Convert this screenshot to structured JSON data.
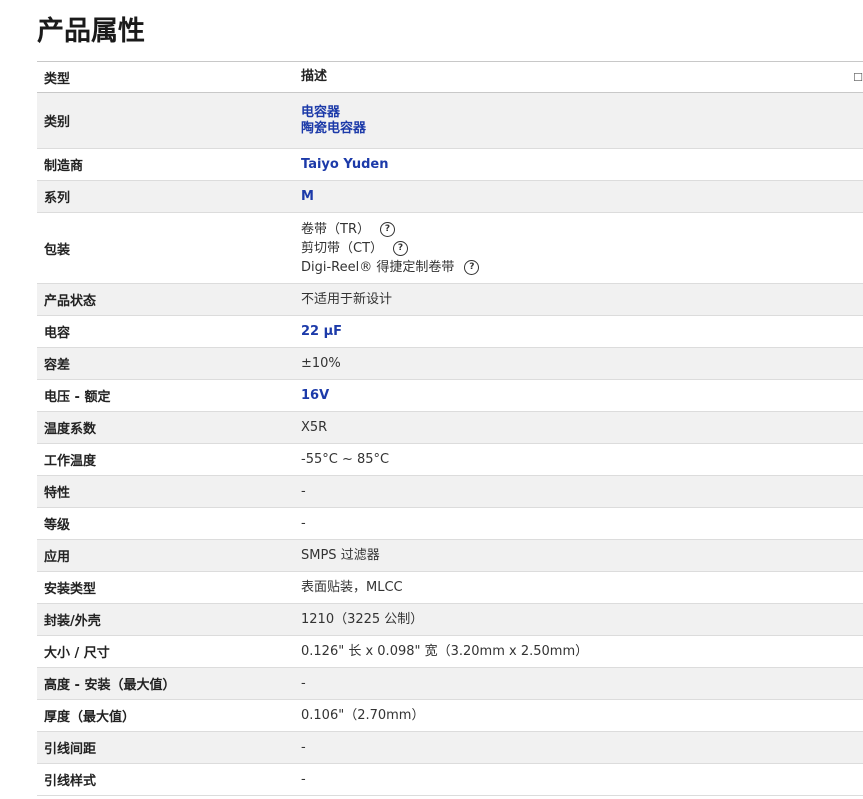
{
  "page": {
    "title": "产品属性"
  },
  "table": {
    "headers": {
      "type": "类型",
      "description": "描述"
    },
    "rows": [
      {
        "label": "类别",
        "values": [
          "电容器",
          "陶瓷电容器"
        ],
        "style": "link"
      },
      {
        "label": "制造商",
        "values": [
          "Taiyo Yuden"
        ],
        "style": "link"
      },
      {
        "label": "系列",
        "values": [
          "M"
        ],
        "style": "link"
      },
      {
        "label": "包装",
        "values": [
          "卷带（TR）",
          "剪切带（CT）",
          "Digi-Reel® 得捷定制卷带"
        ],
        "style": "help"
      },
      {
        "label": "产品状态",
        "values": [
          "不适用于新设计"
        ],
        "style": "plain"
      },
      {
        "label": "电容",
        "values": [
          "22 µF"
        ],
        "style": "link"
      },
      {
        "label": "容差",
        "values": [
          "±10%"
        ],
        "style": "plain"
      },
      {
        "label": "电压 - 额定",
        "values": [
          "16V"
        ],
        "style": "link"
      },
      {
        "label": "温度系数",
        "values": [
          "X5R"
        ],
        "style": "plain"
      },
      {
        "label": "工作温度",
        "values": [
          "-55°C ~ 85°C"
        ],
        "style": "plain"
      },
      {
        "label": "特性",
        "values": [
          "-"
        ],
        "style": "plain"
      },
      {
        "label": "等级",
        "values": [
          "-"
        ],
        "style": "plain"
      },
      {
        "label": "应用",
        "values": [
          "SMPS 过滤器"
        ],
        "style": "plain"
      },
      {
        "label": "安装类型",
        "values": [
          "表面贴装，MLCC"
        ],
        "style": "plain"
      },
      {
        "label": "封装/外壳",
        "values": [
          "1210（3225 公制）"
        ],
        "style": "plain"
      },
      {
        "label": "大小 / 尺寸",
        "values": [
          "0.126\" 长 x 0.098\" 宽（3.20mm x 2.50mm）"
        ],
        "style": "plain"
      },
      {
        "label": "高度 - 安装（最大值）",
        "values": [
          "-"
        ],
        "style": "plain"
      },
      {
        "label": "厚度（最大值）",
        "values": [
          "0.106\"（2.70mm）"
        ],
        "style": "plain"
      },
      {
        "label": "引线间距",
        "values": [
          "-"
        ],
        "style": "plain"
      },
      {
        "label": "引线样式",
        "values": [
          "-"
        ],
        "style": "plain"
      }
    ]
  },
  "icons": {
    "help": "question-circle-icon"
  },
  "colors": {
    "link": "#1c3aa9",
    "row_alt": "#f1f1f1"
  }
}
